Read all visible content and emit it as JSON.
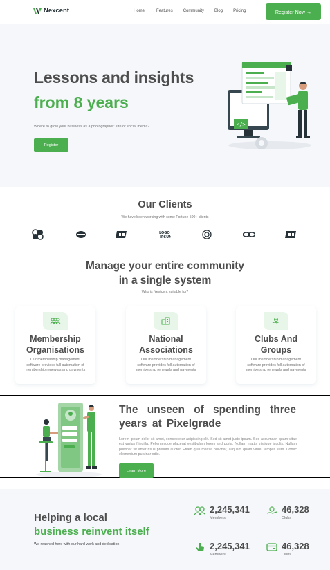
{
  "nav": {
    "brand": "Nexcent",
    "links": [
      "Home",
      "Features",
      "Community",
      "Blog",
      "Pricing"
    ],
    "cta": "Register Now →"
  },
  "hero": {
    "title_line1": "Lessons and insights",
    "title_line2": "from 8 years",
    "subtitle": "Where to grow your business as a photographer: site or social media?",
    "button": "Register"
  },
  "clients": {
    "title": "Our Clients",
    "subtitle": "We have been working with some Fortune 500+ clients",
    "logos": [
      "client-logo-1",
      "client-logo-2",
      "client-logo-3",
      "client-logo-4",
      "client-logo-5",
      "client-logo-6",
      "client-logo-7"
    ]
  },
  "manage": {
    "title_line1": "Manage your entire community",
    "title_line2": "in a single system",
    "subtitle": "Who is Nextcent suitable for?",
    "cards": [
      {
        "title_line1": "Membership",
        "title_line2": "Organisations",
        "desc": "Our membership management software provides full automation of membership renewals and payments",
        "icon": "members-icon"
      },
      {
        "title_line1": "National",
        "title_line2": "Associations",
        "desc": "Our membership management software provides full automation of membership renewals and payments",
        "icon": "building-icon"
      },
      {
        "title_line1": "Clubs And",
        "title_line2": "Groups",
        "desc": "Our membership management software provides full automation of membership renewals and payments",
        "icon": "hand-icon"
      }
    ]
  },
  "unseen": {
    "title_line1": "The unseen of spending three",
    "title_line2": "years at Pixelgrade",
    "text": "Lorem ipsum dolor sit amet, consectetur adipiscing elit. Sed sit amet justo ipsum. Sed accumsan quam vitae est varius fringilla. Pellentesque placerat vestibulum lorem sed porta. Nullam mattis tristique iaculis. Nullam pulvinar sit amet risus pretium auctor. Etiam quis massa pulvinar, aliquam quam vitae, tempus sem. Donec elementum pulvinar odio.",
    "button": "Learn More"
  },
  "stats": {
    "title_line1": "Helping a local",
    "title_line2": "business reinvent itself",
    "subtitle": "We reached here with our hard work and dedication",
    "items": [
      {
        "value": "2,245,341",
        "label": "Members",
        "icon": "members-icon"
      },
      {
        "value": "46,328",
        "label": "Clubs",
        "icon": "hand-icon"
      },
      {
        "value": "2,245,341",
        "label": "Members",
        "icon": "click-icon"
      },
      {
        "value": "46,328",
        "label": "Clubs",
        "icon": "payment-icon"
      }
    ]
  },
  "colors": {
    "primary": "#4caf4f",
    "text": "#4d4d4d",
    "muted": "#717171",
    "section_bg": "#f5f7fa"
  }
}
